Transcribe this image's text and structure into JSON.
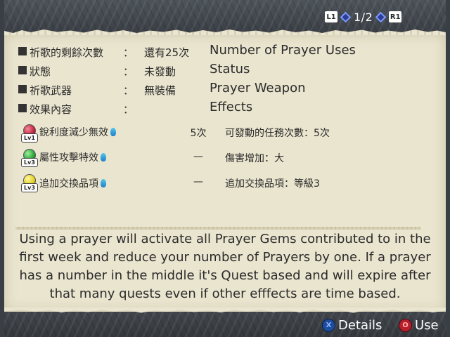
{
  "pager": {
    "left_button": "L1",
    "page": "1/2",
    "right_button": "R1"
  },
  "rows": [
    {
      "label": "祈歌的剩餘次數",
      "colon": "：",
      "value": "還有25次",
      "english": "Number of Prayer Uses"
    },
    {
      "label": "狀態",
      "colon": "：",
      "value": "未發動",
      "english": "Status"
    },
    {
      "label": "祈歌武器",
      "colon": "：",
      "value": "無裝備",
      "english": "Prayer Weapon"
    },
    {
      "label": "效果內容",
      "colon": "：",
      "value": "",
      "english": "Effects"
    }
  ],
  "gems": [
    {
      "level": "Lv1",
      "color": "#c2223e",
      "name": "銳利度減少無效",
      "value": "5次",
      "effect": "可發動的任務次數：5次"
    },
    {
      "level": "Lv3",
      "color": "#2aa33a",
      "name": "屬性攻擊特效",
      "value": "—",
      "effect": "傷害增加：大"
    },
    {
      "level": "Lv3",
      "color": "#e4d21c",
      "name": "追加交換品項",
      "value": "—",
      "effect": "追加交換品項：等級3"
    }
  ],
  "description": "Using a prayer will activate all Prayer Gems contributed to in the first week and reduce your number of Prayers by one. If a prayer has a number in the middle it's Quest based and will expire after that many quests even if other efffects are time based.",
  "hints": {
    "details_button": "X",
    "details": "Details",
    "use_button": "O",
    "use": "Use"
  },
  "colors": {
    "paper": "#eae5cf",
    "frame": "#3c4147",
    "text": "#2b2b2b"
  }
}
